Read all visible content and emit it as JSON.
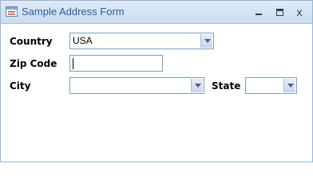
{
  "window": {
    "title": "Sample Address Form",
    "minimize_label": "minimize",
    "maximize_label": "maximize",
    "close_label": "x"
  },
  "form": {
    "country": {
      "label": "Country",
      "value": "USA"
    },
    "zip": {
      "label": "Zip Code",
      "value": ""
    },
    "city": {
      "label": "City",
      "value": ""
    },
    "state": {
      "label": "State",
      "value": ""
    }
  }
}
